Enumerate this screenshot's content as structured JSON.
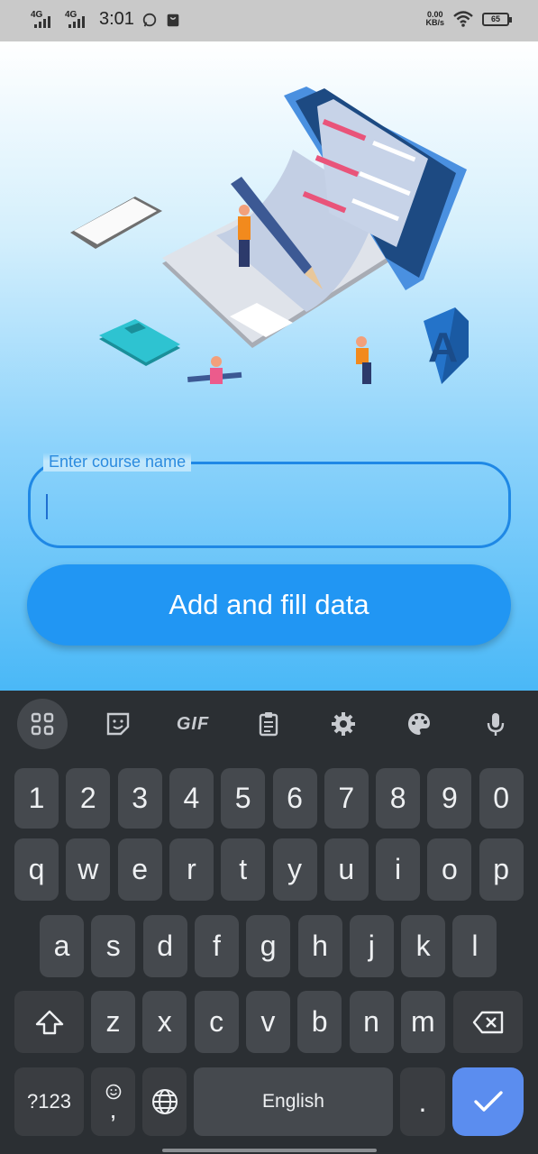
{
  "status_bar": {
    "network1": "4G",
    "network2": "4G",
    "time": "3:01",
    "data_speed_value": "0.00",
    "data_speed_unit": "KB/s",
    "battery": "65"
  },
  "form": {
    "course_label": "Enter course name",
    "course_value": "",
    "submit_label": "Add and fill data"
  },
  "keyboard": {
    "toolbar": [
      "apps-grid-icon",
      "sticker-icon",
      "GIF",
      "clipboard-icon",
      "gear-icon",
      "palette-icon",
      "mic-icon"
    ],
    "gif_label": "GIF",
    "row_numbers": [
      "1",
      "2",
      "3",
      "4",
      "5",
      "6",
      "7",
      "8",
      "9",
      "0"
    ],
    "row1": [
      "q",
      "w",
      "e",
      "r",
      "t",
      "y",
      "u",
      "i",
      "o",
      "p"
    ],
    "row2": [
      "a",
      "s",
      "d",
      "f",
      "g",
      "h",
      "j",
      "k",
      "l"
    ],
    "row3": [
      "z",
      "x",
      "c",
      "v",
      "b",
      "n",
      "m"
    ],
    "symbols_label": "?123",
    "comma": ",",
    "space_label": "English",
    "period": "."
  },
  "colors": {
    "accent": "#2196f3",
    "outline": "#1f88e5",
    "keyboard_bg": "#2b2f33",
    "key_bg": "#45494e",
    "enter_key": "#5b8def"
  }
}
